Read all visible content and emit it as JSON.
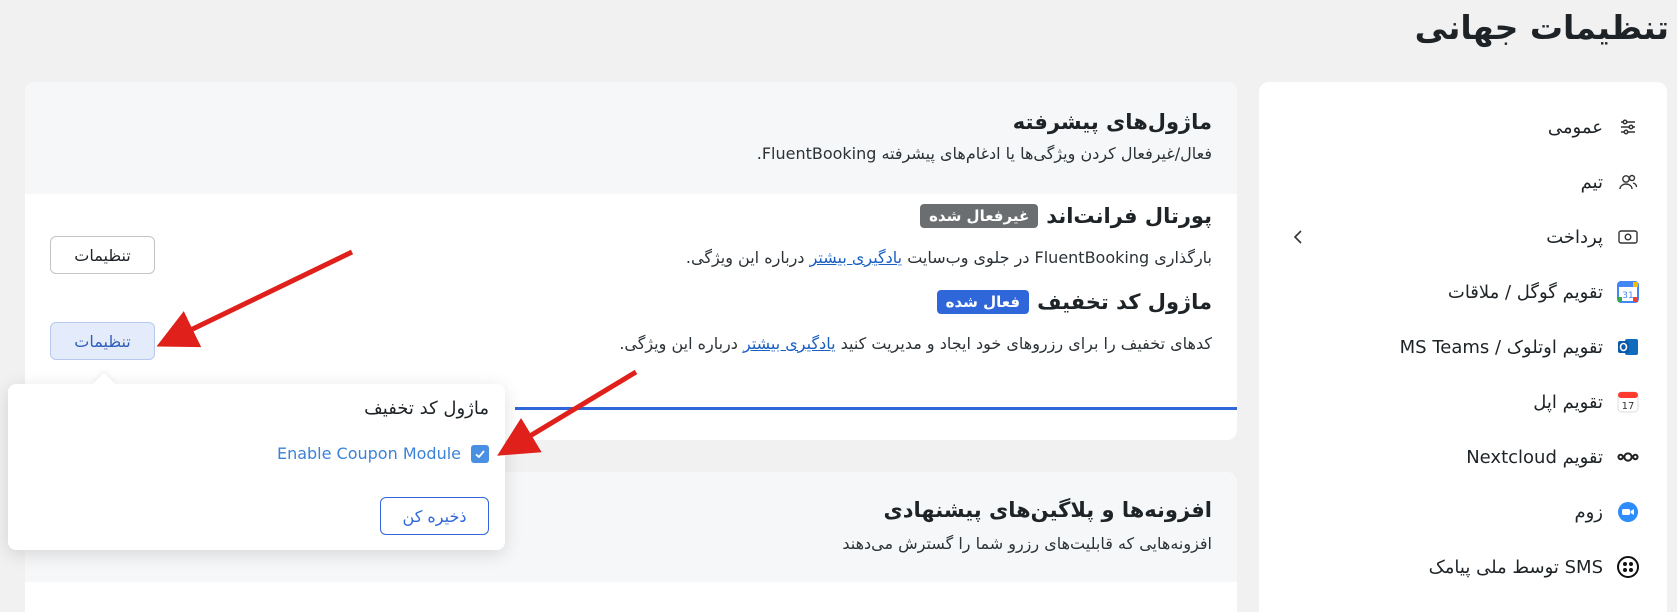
{
  "page": {
    "title": "تنظیمات جهانی"
  },
  "sidebar": {
    "items": [
      {
        "label": "عمومی",
        "icon": "sliders-icon"
      },
      {
        "label": "تیم",
        "icon": "team-icon"
      },
      {
        "label": "پرداخت",
        "icon": "payment-icon"
      },
      {
        "label": "تقویم گوگل / ملاقات",
        "icon": "google-calendar-icon"
      },
      {
        "label": "تقویم اوتلوک / MS Teams",
        "icon": "outlook-icon"
      },
      {
        "label": "تقویم اپل",
        "icon": "apple-calendar-icon"
      },
      {
        "label": "تقویم Nextcloud",
        "icon": "nextcloud-icon"
      },
      {
        "label": "زوم",
        "icon": "zoom-icon"
      },
      {
        "label": "SMS توسط ملی پیامک",
        "icon": "sms-icon"
      }
    ],
    "google_calendar_day": "31",
    "apple_calendar_day": "17"
  },
  "modules": {
    "title": "ماژول‌های پیشرفته",
    "description": "فعال/غیرفعال کردن ویژگی‌ها یا ادغام‌های پیشرفته FluentBooking.",
    "frontend_portal": {
      "title": "پورتال فرانت‌اند",
      "badge": "غیرفعال شده",
      "desc_before": "بارگذاری FluentBooking در جلوی وب‌سایت ",
      "desc_link": "یادگیری بیشتر",
      "desc_after": " درباره این ویژگی.",
      "settings_label": "تنظیمات"
    },
    "coupon": {
      "title": "ماژول کد تخفیف",
      "badge": "فعال شده",
      "desc_before": "کدهای تخفیف را برای رزروهای خود ایجاد و مدیریت کنید ",
      "desc_link": "یادگیری بیشتر",
      "desc_after": " درباره این ویژگی.",
      "settings_label": "تنظیمات"
    }
  },
  "addons": {
    "title": "افزونه‌ها و پلاگین‌های پیشنهادی",
    "description": "افزونه‌هایی که قابلیت‌های رزرو شما را گسترش می‌دهند"
  },
  "popover": {
    "title": "ماژول کد تخفیف",
    "checkbox_label": "Enable Coupon Module",
    "checked": true,
    "save_label": "ذخیره کن"
  },
  "colors": {
    "accent": "#2f66d9",
    "disabled_badge": "#6b6e70",
    "annotation_arrow": "#e0201b"
  }
}
